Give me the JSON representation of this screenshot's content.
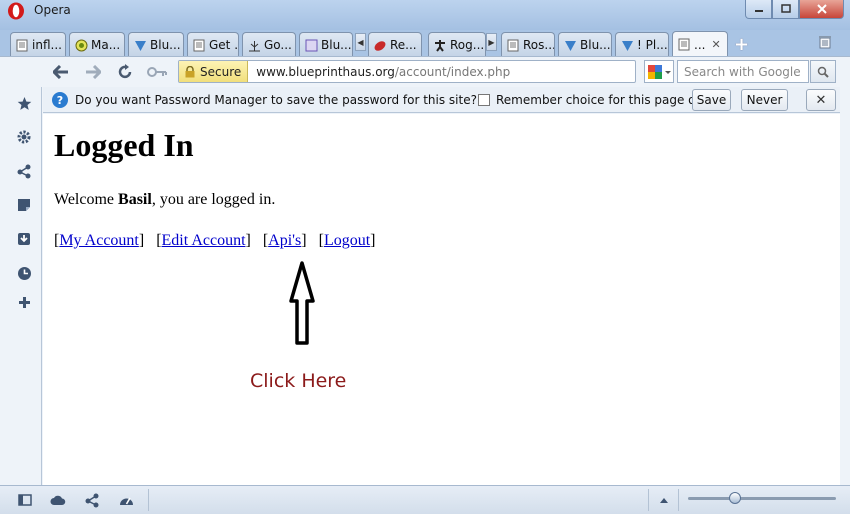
{
  "window": {
    "title": "Opera"
  },
  "tabs": [
    {
      "label": "infl...",
      "icon": "document-icon"
    },
    {
      "label": "Ma...",
      "icon": "target-icon"
    },
    {
      "label": "Blu...",
      "icon": "blueprint-icon"
    },
    {
      "label": "Get ...",
      "icon": "document-icon"
    },
    {
      "label": "Go...",
      "icon": "antenna-icon"
    },
    {
      "label": "Blu...",
      "icon": "frame-icon"
    },
    {
      "label": "Re...",
      "icon": "bug-icon"
    },
    {
      "label": "Rog...",
      "icon": "figure-icon"
    },
    {
      "label": "Ros...",
      "icon": "document-icon"
    },
    {
      "label": "Blu...",
      "icon": "blueprint-icon"
    },
    {
      "label": "! Pl...",
      "icon": "blueprint-icon"
    },
    {
      "label": "...",
      "icon": "document-icon",
      "active": true
    }
  ],
  "toolbar": {
    "secure_label": "Secure",
    "url_host": "www.blueprinthaus.org",
    "url_path": "/account/index.php",
    "search_placeholder": "Search with Google"
  },
  "password_bar": {
    "message": "Do you want Password Manager to save the password for this site?",
    "remember_label": "Remember choice for this page only",
    "save_label": "Save",
    "never_label": "Never",
    "close_label": "✕"
  },
  "page": {
    "heading": "Logged In",
    "welcome_prefix": "Welcome ",
    "username": "Basil",
    "welcome_suffix": ", you are  logged in.",
    "links": [
      {
        "label": "My Account"
      },
      {
        "label": "Edit Account"
      },
      {
        "label": "Api's"
      },
      {
        "label": "Logout"
      }
    ],
    "annotation": "Click Here"
  },
  "colors": {
    "link": "#0000cc",
    "annotation": "#8b1a1a",
    "chrome": "#eef3f9"
  }
}
